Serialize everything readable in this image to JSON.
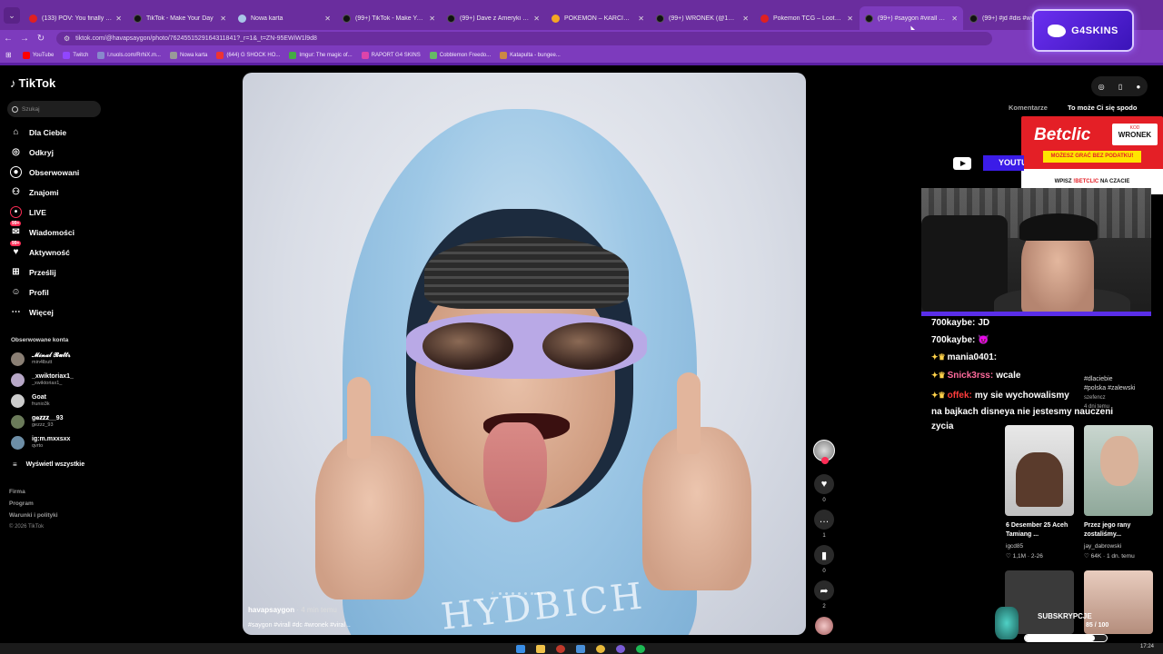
{
  "browser": {
    "tabs": [
      {
        "title": "(133) POV: You finally upgrad",
        "fav": "red"
      },
      {
        "title": "TikTok - Make Your Day",
        "fav": "tiktok"
      },
      {
        "title": "Nowa karta",
        "fav": "globe"
      },
      {
        "title": "(99+) TikTok - Make Your Day",
        "fav": "tiktok"
      },
      {
        "title": "(99+) Dave z Ameryki Stand U",
        "fav": "tiktok"
      },
      {
        "title": "POKEMON – KARCIOCH",
        "fav": "orange"
      },
      {
        "title": "(99+) WRONEK (@1wronek) |",
        "fav": "tiktok"
      },
      {
        "title": "Pokemon TCG – LootQuest.pl",
        "fav": "red"
      },
      {
        "title": "(99+) #saygon #virall #dc #w",
        "fav": "tiktok",
        "active": true
      },
      {
        "title": "(99+) #jd #dis #wywiad",
        "fav": "tiktok"
      }
    ],
    "url": "tiktok.com/@havapsaygon/photo/7624551529164311841?_r=1&_t=ZN-95EWiW1l9d8",
    "bookmarks": [
      "YouTube",
      "Twitch",
      "l.nuols.com/RrhiX.m...",
      "Nowa karta",
      "(644) G SHOCK HO...",
      "Imgur: The magic of...",
      "RAPORT G4 SKINS",
      "Cobblemon Freedo...",
      "Katapulta - bungee..."
    ],
    "close_glyph": "✕",
    "tab_menu_glyph": "⌄"
  },
  "overlay": {
    "g4skins": "G4SKINS",
    "betclic_logo": "Betclic",
    "betclic_kod": "KOD",
    "betclic_code": "WRONEK",
    "betclic_bar": "MOŻESZ GRAĆ BEZ PODATKU!",
    "betclic_bottom_pre": "WPISZ",
    "betclic_bottom_brand": "!BETCLIC",
    "betclic_bottom_post": "NA CZACIE",
    "youtube_btn": "YOUTU",
    "chat": [
      {
        "nick": "700kaybe:",
        "msg": "JD"
      },
      {
        "nick": "700kaybe:",
        "msg": "😈"
      },
      {
        "nick": "mania0401:",
        "msg": ""
      },
      {
        "nick": "Snick3rss:",
        "msg": "wcale"
      },
      {
        "nick": "offek:",
        "msg": "my sie wychowalismy"
      }
    ],
    "chat_wrap": "na bajkach disneya nie jestesmy nauczeni",
    "chat_wrap2": "zycia",
    "subs_label": "SUBSKRYPCJE",
    "subs_count": "85 / 100",
    "subs_fraction": 0.85
  },
  "sidebar": {
    "brand": "TikTok",
    "search_placeholder": "Szukaj",
    "nav": [
      {
        "label": "Dla Ciebie",
        "icon": "home-icon",
        "glyph": "⌂"
      },
      {
        "label": "Odkryj",
        "icon": "compass-icon",
        "glyph": "◎"
      },
      {
        "label": "Obserwowani",
        "icon": "following-icon",
        "glyph": "●"
      },
      {
        "label": "Znajomi",
        "icon": "friends-icon",
        "glyph": "⚇"
      },
      {
        "label": "LIVE",
        "icon": "live-icon",
        "glyph": "•"
      },
      {
        "label": "Wiadomości",
        "icon": "messages-icon",
        "glyph": "✉",
        "badge": "99+"
      },
      {
        "label": "Aktywność",
        "icon": "activity-icon",
        "glyph": "♥",
        "badge": "99+"
      },
      {
        "label": "Prześlij",
        "icon": "upload-icon",
        "glyph": "⊞"
      },
      {
        "label": "Profil",
        "icon": "profile-icon",
        "glyph": "☺"
      },
      {
        "label": "Więcej",
        "icon": "more-icon",
        "glyph": "⋯"
      }
    ],
    "following_title": "Obserwowane konta",
    "accounts": [
      {
        "name": "𝓜𝓲𝓷𝓪𝓵 𝓑𝓾𝓽𝓽𝓻",
        "handle": "min4lbutt"
      },
      {
        "name": "_xwiktoriax1_",
        "handle": "_xwiktoriax1_"
      },
      {
        "name": "Goat",
        "handle": "frunio3k"
      },
      {
        "name": "g𝐞𝐳𝐳𝐳__93",
        "handle": "gezzz_93"
      },
      {
        "name": "ig:m.mxxsxx",
        "handle": "qvrto"
      }
    ],
    "see_all": "Wyświetl wszystkie",
    "footer": [
      "Firma",
      "Program",
      "Warunki i polityki"
    ],
    "copyright": "© 2026 TikTok"
  },
  "post": {
    "username": "havapsaygon",
    "time": "· 4 min temu",
    "tags": "#saygon #virall #dc #wronek #viral ..",
    "shirt_text": "HYDBICH",
    "likes": "0",
    "comments": "1",
    "saves": "0",
    "shares": "2",
    "carousel_prev": "‹",
    "carousel_next": "›"
  },
  "right": {
    "tab_comments": "Komentarze",
    "tab_suggest": "To może Ci się spodo",
    "hashtags": [
      "#dlaciebie",
      "#polska #zalewski",
      "szefencz",
      "4 dni temu"
    ],
    "cards": [
      {
        "title": "6 Desember 25 Aceh Tamiang ...",
        "user": "igcd85",
        "likes": "♡ 1,1M",
        "date": "· 2-26"
      },
      {
        "title": "Przez jego rany zostaliśmy...",
        "user": "jay_dabrowski",
        "likes": "♡ 64K",
        "date": "· 1 dn. temu"
      }
    ]
  },
  "taskbar": {
    "time": "17:24"
  }
}
